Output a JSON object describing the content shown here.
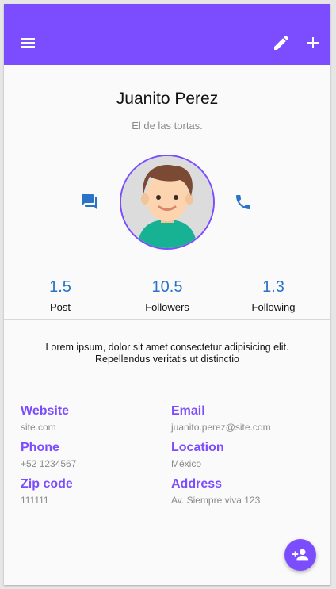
{
  "colors": {
    "primary": "#7c4dff",
    "accent_blue": "#2a73c7",
    "muted": "#8a8a8a"
  },
  "header": {
    "icons": [
      "menu-icon",
      "pencil-icon",
      "plus-icon"
    ]
  },
  "profile": {
    "name": "Juanito Perez",
    "tagline": "El de las tortas."
  },
  "stats": [
    {
      "value": "1.5",
      "label": "Post"
    },
    {
      "value": "10.5",
      "label": "Followers"
    },
    {
      "value": "1.3",
      "label": "Following"
    }
  ],
  "bio": "Lorem ipsum, dolor sit amet consectetur adipisicing elit. Repellendus veritatis ut distinctio",
  "details": [
    {
      "key": "Website",
      "value": "site.com"
    },
    {
      "key": "Email",
      "value": "juanito.perez@site.com"
    },
    {
      "key": "Phone",
      "value": "+52 1234567"
    },
    {
      "key": "Location",
      "value": "México"
    },
    {
      "key": "Zip code",
      "value": "111111"
    },
    {
      "key": "Address",
      "value": "Av. Siempre viva 123"
    }
  ]
}
